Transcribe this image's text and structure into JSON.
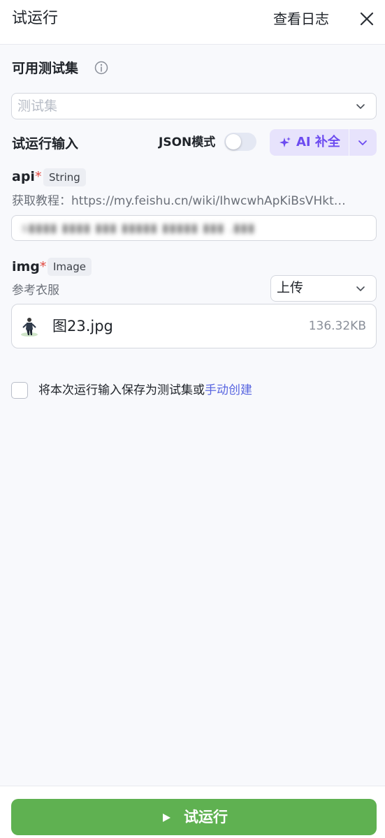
{
  "header": {
    "title": "试运行",
    "view_logs_label": "查看日志"
  },
  "test_set": {
    "title": "可用测试集",
    "placeholder": "测试集"
  },
  "run_input": {
    "title": "试运行输入",
    "json_mode_label": "JSON模式",
    "json_mode_on": false,
    "ai_complete_label": "AI 补全"
  },
  "fields": {
    "api": {
      "name": "api",
      "required_mark": "*",
      "type": "String",
      "description": "获取教程：https://my.feishu.cn/wiki/IhwcwhApKiBsVHkt…",
      "value_blurred": "s▮▮▮▮ ▮▮▮▮ ▮▮▮ ▮▮▮▮▮ ▮▮▮▮▮ ▮▮▮ .▮▮▮"
    },
    "img": {
      "name": "img",
      "required_mark": "*",
      "type": "Image",
      "description": "参考衣服",
      "source_select": "上传",
      "file": {
        "name": "图23.jpg",
        "size": "136.32KB"
      }
    }
  },
  "save_option": {
    "text": "将本次运行输入保存为测试集或",
    "link": "手动创建",
    "checked": false
  },
  "footer": {
    "run_label": "试运行"
  },
  "colors": {
    "accent_green": "#5fb151",
    "ai_purple": "#6c4bf0",
    "link_blue": "#5865e0",
    "required_red": "#e0473e"
  }
}
